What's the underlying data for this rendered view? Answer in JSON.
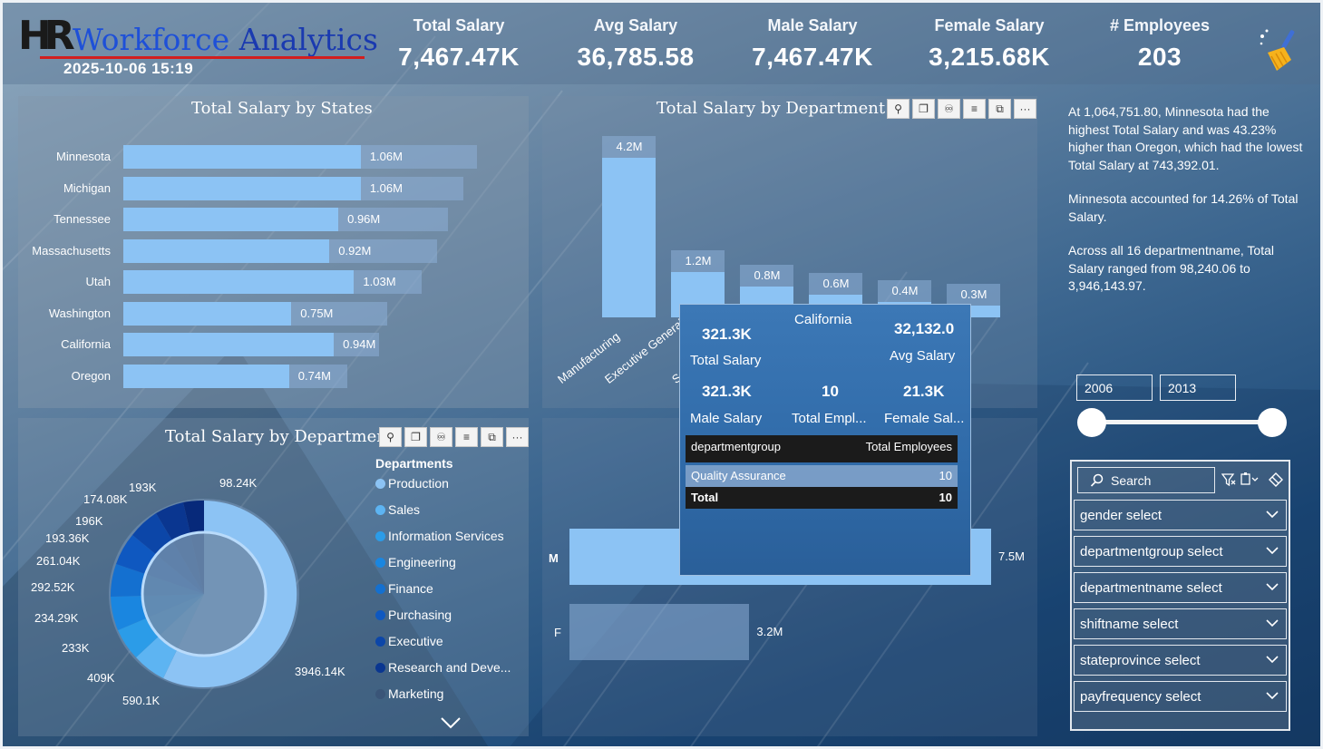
{
  "header": {
    "logo_hr": "HR",
    "logo_title_1": "Workforce",
    "logo_title_2": "Analytics",
    "timestamp": "2025-10-06 15:19",
    "kpis": [
      {
        "label": "Total Salary",
        "value": "7,467.47K"
      },
      {
        "label": "Avg Salary",
        "value": "36,785.58"
      },
      {
        "label": "Male Salary",
        "value": "7,467.47K"
      },
      {
        "label": "Female Salary",
        "value": "3,215.68K"
      },
      {
        "label": "# Employees",
        "value": "203"
      }
    ],
    "clear_icon": "broom-icon"
  },
  "states_chart": {
    "title": "Total Salary by States",
    "chart_data": {
      "type": "bar",
      "categories": [
        "Minnesota",
        "Michigan",
        "Tennessee",
        "Massachusetts",
        "Utah",
        "Washington",
        "California",
        "Oregon"
      ],
      "values": [
        1.06,
        1.06,
        0.96,
        0.92,
        1.03,
        0.75,
        0.94,
        0.74
      ],
      "background_values": [
        1.58,
        1.52,
        1.45,
        1.4,
        1.33,
        1.18,
        1.14,
        1.0
      ],
      "data_labels": [
        "1.06M",
        "1.06M",
        "0.96M",
        "0.92M",
        "1.03M",
        "0.75M",
        "0.94M",
        "0.74M"
      ]
    }
  },
  "deptgroup_chart": {
    "title": "Total Salary by Department G",
    "chart_data": {
      "type": "bar",
      "categories": [
        "Manufacturing",
        "Executive General...",
        "S..."
      ],
      "values": [
        4.2,
        1.2,
        0.8,
        0.6,
        0.4,
        0.3
      ],
      "data_labels": [
        "4.2M",
        "1.2M",
        "0.8M",
        "0.6M",
        "0.4M",
        "0.3M"
      ]
    }
  },
  "visual_toolbar": {
    "pin_icon": "pin-icon",
    "copy_icon": "copy-icon",
    "bell_icon": "bell-icon",
    "filter_icon": "filter-icon",
    "focus_icon": "focus-mode-icon",
    "more_icon": "more-options-icon",
    "more_label": "···"
  },
  "tooltip": {
    "title": "California",
    "total_salary_value": "321.3K",
    "total_salary_label": "Total Salary",
    "avg_salary_value": "32,132.0",
    "avg_salary_label": "Avg Salary",
    "male_value": "321.3K",
    "male_label": "Male Salary",
    "emp_value": "10",
    "emp_label": "Total Empl...",
    "female_value": "21.3K",
    "female_label": "Female Sal...",
    "table": {
      "col1": "departmentgroup",
      "col2": "Total Employees",
      "rows": [
        {
          "name": "Quality Assurance",
          "value": "10"
        }
      ],
      "total_label": "Total",
      "total_value": "10"
    }
  },
  "gender_chart": {
    "chart_data": {
      "type": "bar",
      "categories": [
        "M",
        "F"
      ],
      "values": [
        7.5,
        3.2
      ],
      "data_labels": [
        "7.5M",
        "3.2M"
      ]
    }
  },
  "dept_chart": {
    "title": "Total Salary by Department",
    "legend_title": "Departments",
    "legend": [
      {
        "label": "Production",
        "color": "#8cc3f4"
      },
      {
        "label": "Sales",
        "color": "#5db4f2"
      },
      {
        "label": "Information Services",
        "color": "#2b9ce8"
      },
      {
        "label": "Engineering",
        "color": "#1a86e0"
      },
      {
        "label": "Finance",
        "color": "#1470d0"
      },
      {
        "label": "Purchasing",
        "color": "#0f58c0"
      },
      {
        "label": "Executive",
        "color": "#0c46a8"
      },
      {
        "label": "Research and Deve...",
        "color": "#0a3690"
      },
      {
        "label": "Marketing",
        "color": "#3a5578"
      }
    ],
    "chart_data": {
      "type": "pie",
      "data_labels": [
        "3946.14K",
        "590.1K",
        "409K",
        "233K",
        "234.29K",
        "292.52K",
        "261.04K",
        "193.36K",
        "196K",
        "174.08K",
        "193K",
        "98.24K"
      ]
    },
    "scroll_icon": "chevron-down-icon"
  },
  "narrative": {
    "p1": "At 1,064,751.80, Minnesota had the highest Total Salary and was 43.23% higher than Oregon, which had the lowest Total Salary at 743,392.01.",
    "p2": "Minnesota accounted for 14.26% of Total Salary.",
    "p3": "Across all 16 departmentname, Total Salary ranged from 98,240.06 to 3,946,143.97."
  },
  "year_slicer": {
    "start": "2006",
    "end": "2013"
  },
  "filters": {
    "search_placeholder": "Search",
    "items": [
      "gender select",
      "departmentgroup select",
      "departmentname select",
      "shiftname select",
      "stateprovince select",
      "payfrequency select"
    ]
  }
}
